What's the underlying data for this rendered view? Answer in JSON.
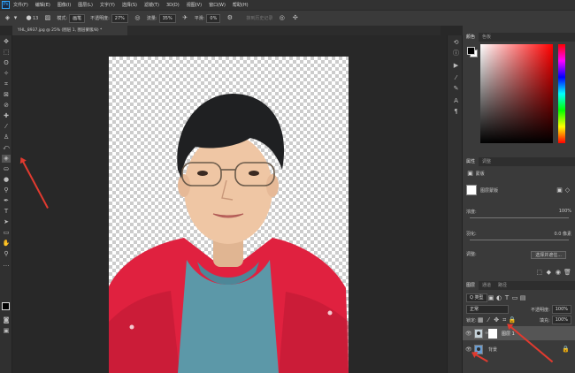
{
  "menubar": {
    "logo": "Ps",
    "items": [
      "文件(F)",
      "编辑(E)",
      "图像(I)",
      "图层(L)",
      "文字(Y)",
      "选择(S)",
      "滤镜(T)",
      "3D(D)",
      "视图(V)",
      "窗口(W)",
      "帮助(H)"
    ]
  },
  "options": {
    "brush_size": "13",
    "mode_label": "模式:",
    "mode_value": "画笔",
    "opacity_label": "不透明度:",
    "opacity_value": "27%",
    "flow_label": "流量:",
    "flow_value": "35%",
    "smooth_label": "平滑:",
    "smooth_value": "0%",
    "erase_history": "抹到历史记录"
  },
  "document": {
    "tab_title": "YHL_8937.jpg @ 25% (图层 1, 图层蒙版/8) *"
  },
  "color_panel": {
    "tabs": [
      "颜色",
      "色板"
    ],
    "fg_color": "#000000",
    "bg_color": "#ffffff"
  },
  "properties_panel": {
    "tabs": [
      "属性",
      "调整"
    ],
    "mask_label": "蒙版",
    "layer_mask_label": "图层蒙版",
    "density_label": "浓度:",
    "density_value": "100%",
    "feather_label": "羽化:",
    "feather_value": "0.0 像素",
    "refine_label": "调整:",
    "select_and_mask": "选择并遮住..."
  },
  "layers_panel": {
    "tabs": [
      "图层",
      "通道",
      "路径"
    ],
    "kind_filter": "Q 类型",
    "blend_mode": "正常",
    "opacity_label": "不透明度:",
    "opacity_value": "100%",
    "lock_label": "锁定:",
    "fill_label": "填充:",
    "fill_value": "100%",
    "layers": [
      {
        "name": "图层 1"
      },
      {
        "name": "背景"
      }
    ]
  },
  "colors": {
    "arrow": "#e03a2f",
    "jacket": "#e0213f",
    "sweater": "#5c98a8"
  }
}
